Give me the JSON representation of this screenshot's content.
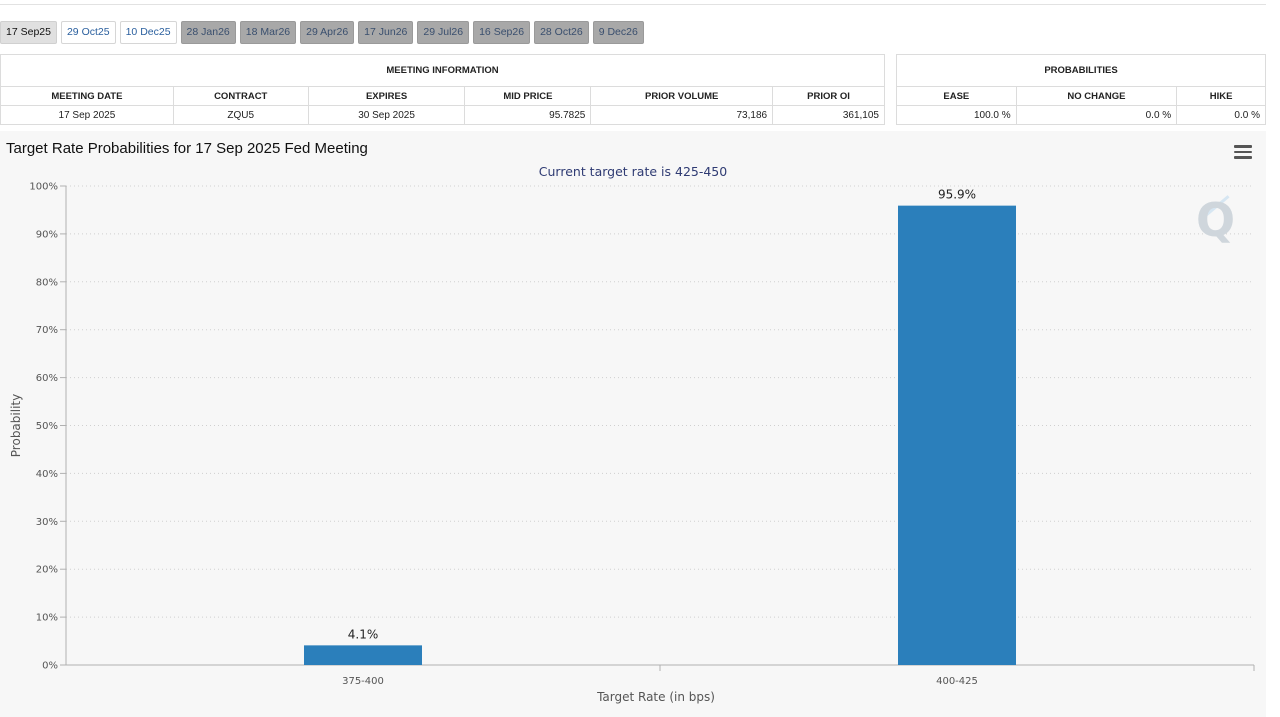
{
  "tabs": [
    {
      "label": "17 Sep25",
      "state": "active"
    },
    {
      "label": "29 Oct25",
      "state": "linked"
    },
    {
      "label": "10 Dec25",
      "state": "linked"
    },
    {
      "label": "28 Jan26",
      "state": "disabled"
    },
    {
      "label": "18 Mar26",
      "state": "disabled"
    },
    {
      "label": "29 Apr26",
      "state": "disabled"
    },
    {
      "label": "17 Jun26",
      "state": "disabled"
    },
    {
      "label": "29 Jul26",
      "state": "disabled"
    },
    {
      "label": "16 Sep26",
      "state": "disabled"
    },
    {
      "label": "28 Oct26",
      "state": "disabled"
    },
    {
      "label": "9 Dec26",
      "state": "disabled"
    }
  ],
  "meeting_info": {
    "title": "MEETING INFORMATION",
    "headers": [
      "MEETING DATE",
      "CONTRACT",
      "EXPIRES",
      "MID PRICE",
      "PRIOR VOLUME",
      "PRIOR OI"
    ],
    "row": {
      "meeting_date": "17 Sep 2025",
      "contract": "ZQU5",
      "expires": "30 Sep 2025",
      "mid_price": "95.7825",
      "prior_volume": "73,186",
      "prior_oi": "361,105"
    }
  },
  "probabilities": {
    "title": "PROBABILITIES",
    "headers": [
      "EASE",
      "NO CHANGE",
      "HIKE"
    ],
    "row": {
      "ease": "100.0 %",
      "no_change": "0.0 %",
      "hike": "0.0 %"
    }
  },
  "chart": {
    "title": "Target Rate Probabilities for 17 Sep 2025 Fed Meeting",
    "subtitle": "Current target rate is 425-450",
    "watermark": "Q"
  },
  "colors": {
    "bar": "#2b7fbb",
    "grid": "#d0d0d0",
    "axis": "#b0b0b0"
  },
  "chart_data": {
    "type": "bar",
    "categories": [
      "375-400",
      "400-425"
    ],
    "values": [
      4.1,
      95.9
    ],
    "data_labels": [
      "4.1%",
      "95.9%"
    ],
    "xlabel": "Target Rate (in bps)",
    "ylabel": "Probability",
    "ylim": [
      0,
      100
    ],
    "yticks": [
      0,
      10,
      20,
      30,
      40,
      50,
      60,
      70,
      80,
      90,
      100
    ],
    "ytick_labels": [
      "0%",
      "10%",
      "20%",
      "30%",
      "40%",
      "50%",
      "60%",
      "70%",
      "80%",
      "90%",
      "100%"
    ],
    "grid": true,
    "legend": "none"
  }
}
